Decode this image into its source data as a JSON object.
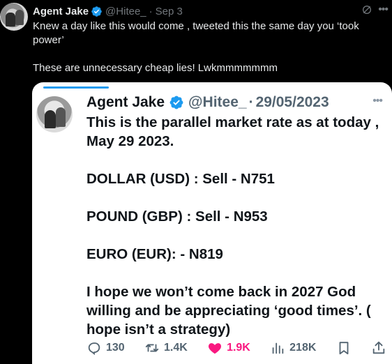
{
  "tweet": {
    "author_name": "Agent Jake",
    "handle": "@Hitee_",
    "separator": "·",
    "date": "Sep 3",
    "text_lines": [
      "Knew a day like this would come , tweeted this the same day you ‘took power’",
      "These are unnecessary cheap lies! Lwkmmmmmmm"
    ]
  },
  "quoted": {
    "author_name": "Agent Jake",
    "handle": "@Hitee_",
    "separator": "·",
    "date": "29/05/2023",
    "paragraphs": [
      "This is the parallel market rate as at today , May 29 2023.",
      "DOLLAR (USD) : Sell - N751",
      "POUND (GBP) : Sell - N953",
      "EURO (EUR): - N819",
      "I hope we won’t come back in 2027 God willing and be appreciating ‘good times’. ( hope isn’t a strategy)"
    ],
    "actions": {
      "replies": "130",
      "retweets": "1.4K",
      "likes": "1.9K",
      "views": "218K"
    }
  },
  "colors": {
    "accent": "#1d9bf0",
    "like": "#f91880",
    "muted_dark": "#71767b",
    "muted_light": "#536471"
  },
  "icons": [
    "verified-badge-icon",
    "grok-icon",
    "more-icon",
    "reply-icon",
    "retweet-icon",
    "like-icon",
    "views-icon",
    "bookmark-icon",
    "share-icon"
  ]
}
